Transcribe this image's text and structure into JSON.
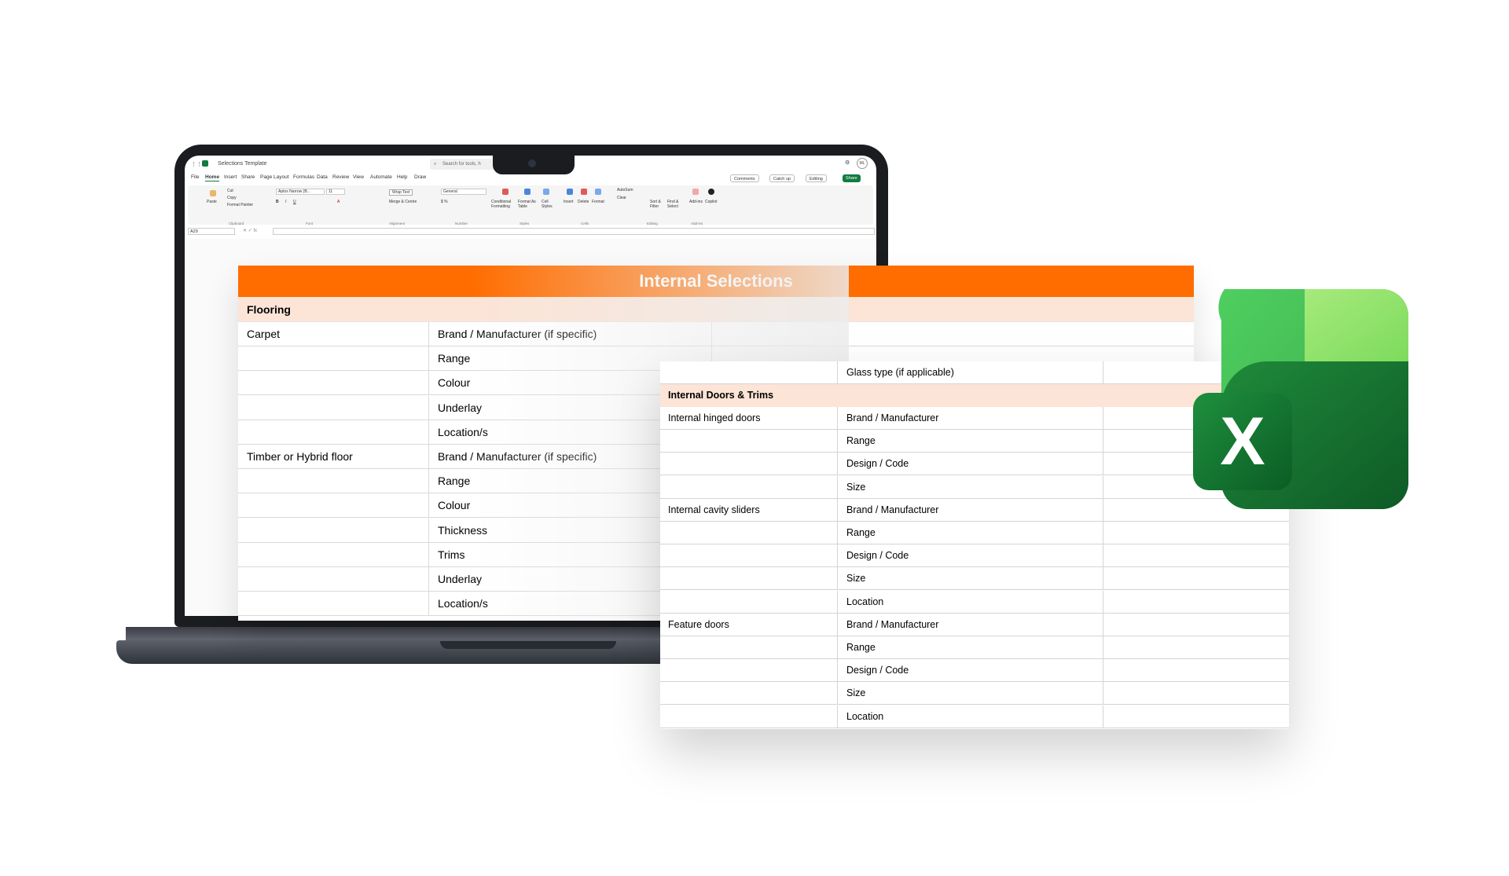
{
  "excel_window": {
    "title": "Selections Template",
    "search_placeholder": "Search for tools, h",
    "avatar_initials": "ML",
    "tabs": [
      "File",
      "Home",
      "Insert",
      "Share",
      "Page Layout",
      "Formulas",
      "Data",
      "Review",
      "View",
      "Automate",
      "Help",
      "Draw"
    ],
    "active_tab": "Home",
    "buttons": {
      "comments": "Comments",
      "catch_up": "Catch up",
      "editing": "Editing",
      "share": "Share"
    },
    "ribbon": {
      "paste": "Paste",
      "cut": "Cut",
      "copy": "Copy",
      "format_painter": "Format Painter",
      "font_name": "Aptos Narrow (B...",
      "font_size": "11",
      "wrap_text": "Wrap Text",
      "merge_centre": "Merge & Centre",
      "number_format": "General",
      "conditional_formatting": "Conditional Formatting",
      "format_as_table": "Format As Table",
      "cell_styles": "Cell Styles",
      "insert": "Insert",
      "delete": "Delete",
      "format": "Format",
      "autosum": "AutoSum",
      "clear": "Clear",
      "sort_filter": "Sort & Filter",
      "find_select": "Find & Select",
      "add_ins": "Add-ins",
      "copilot": "Copilot",
      "groups": [
        "Clipboard",
        "Font",
        "Alignment",
        "Number",
        "Styles",
        "Cells",
        "Editing",
        "Add-ins"
      ]
    },
    "name_box": "A29"
  },
  "sheet_main": {
    "title": "Internal Selections",
    "section": "Flooring",
    "rows": [
      {
        "item": "Carpet",
        "field": "Brand / Manufacturer (if specific)"
      },
      {
        "item": "",
        "field": "Range"
      },
      {
        "item": "",
        "field": "Colour"
      },
      {
        "item": "",
        "field": "Underlay"
      },
      {
        "item": "",
        "field": "Location/s"
      },
      {
        "item": "Timber or Hybrid floor",
        "field": "Brand / Manufacturer (if specific)"
      },
      {
        "item": "",
        "field": "Range"
      },
      {
        "item": "",
        "field": "Colour"
      },
      {
        "item": "",
        "field": "Thickness"
      },
      {
        "item": "",
        "field": "Trims"
      },
      {
        "item": "",
        "field": "Underlay"
      },
      {
        "item": "",
        "field": "Location/s"
      }
    ]
  },
  "sheet_overlay": {
    "first_row": {
      "item": "",
      "field": "Glass type (if applicable)"
    },
    "section": "Internal Doors & Trims",
    "rows": [
      {
        "item": "Internal hinged doors",
        "field": "Brand / Manufacturer"
      },
      {
        "item": "",
        "field": "Range"
      },
      {
        "item": "",
        "field": "Design / Code"
      },
      {
        "item": "",
        "field": "Size"
      },
      {
        "item": "Internal cavity sliders",
        "field": "Brand / Manufacturer"
      },
      {
        "item": "",
        "field": "Range"
      },
      {
        "item": "",
        "field": "Design / Code"
      },
      {
        "item": "",
        "field": "Size"
      },
      {
        "item": "",
        "field": "Location"
      },
      {
        "item": "Feature doors",
        "field": "Brand / Manufacturer"
      },
      {
        "item": "",
        "field": "Range"
      },
      {
        "item": "",
        "field": "Design / Code"
      },
      {
        "item": "",
        "field": "Size"
      },
      {
        "item": "",
        "field": "Location"
      }
    ]
  },
  "logo": {
    "letter": "X"
  },
  "colors": {
    "orange": "#ff6d00",
    "peach": "#fce4d6",
    "excel_green": "#107c41"
  }
}
